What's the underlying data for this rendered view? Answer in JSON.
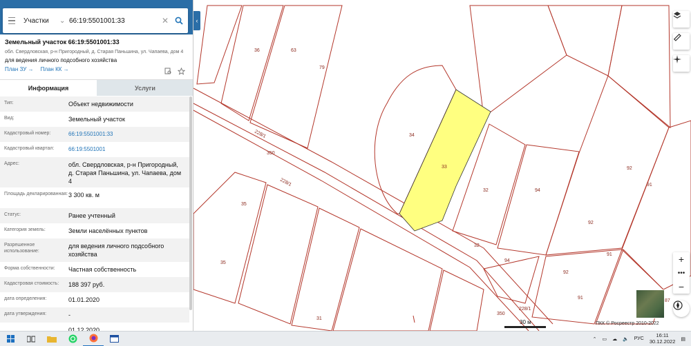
{
  "search": {
    "type_label": "Участки",
    "query": "66:19:5501001:33"
  },
  "object": {
    "title": "Земельный участок 66:19:5501001:33",
    "address": "обл. Свердловская, р-н Пригородный, д. Старая Паньшина, ул. Чапаева, дом 4",
    "purpose": "для ведения личного подсобного хозяйства",
    "link_plan_zu": "План ЗУ →",
    "link_plan_kk": "План КК →"
  },
  "tabs": {
    "info": "Информация",
    "services": "Услуги"
  },
  "info_rows": [
    {
      "key": "Тип:",
      "value": "Объект недвижимости"
    },
    {
      "key": "Вид:",
      "value": "Земельный участок"
    },
    {
      "key": "Кадастровый номер:",
      "value": "66:19:5501001:33"
    },
    {
      "key": "Кадастровый квартал:",
      "value": "66:19:5501001"
    },
    {
      "key": "Адрес:",
      "value": "обл. Свердловская, р-н Пригородный, д. Старая Паньшина, ул. Чапаева, дом 4"
    },
    {
      "key": "Площадь декларированная:",
      "value": "3 300 кв. м"
    },
    {
      "key": "Статус:",
      "value": "Ранее учтенный"
    },
    {
      "key": "Категория земель:",
      "value": "Земли населённых пунктов"
    },
    {
      "key": "Разрешенное использование:",
      "value": "для ведения личного подсобного хозяйства"
    },
    {
      "key": "Форма собственности:",
      "value": "Частная собственность"
    },
    {
      "key": "Кадастровая стоимость:",
      "value": "188 397 руб."
    },
    {
      "key": "дата определения:",
      "value": "01.01.2020"
    },
    {
      "key": "дата утверждения:",
      "value": "-"
    },
    {
      "key": "",
      "value": "01.12.2020"
    }
  ],
  "map": {
    "parcel_numbers": [
      "36",
      "63",
      "79",
      "228/1",
      "350",
      "34",
      "33",
      "228/1",
      "32",
      "94",
      "92",
      "91",
      "35",
      "92",
      "35",
      "32",
      "94",
      "92",
      "91",
      "91",
      "228/1",
      "350",
      "31",
      "87"
    ],
    "scale_label": "30 м",
    "copyright": "ПКК © Росреестр 2010-2022",
    "highlight_color": "#ffff80",
    "boundary_color": "#b3362a"
  },
  "taskbar": {
    "language": "РУС",
    "time": "16:11",
    "date": "30.12.2022"
  }
}
